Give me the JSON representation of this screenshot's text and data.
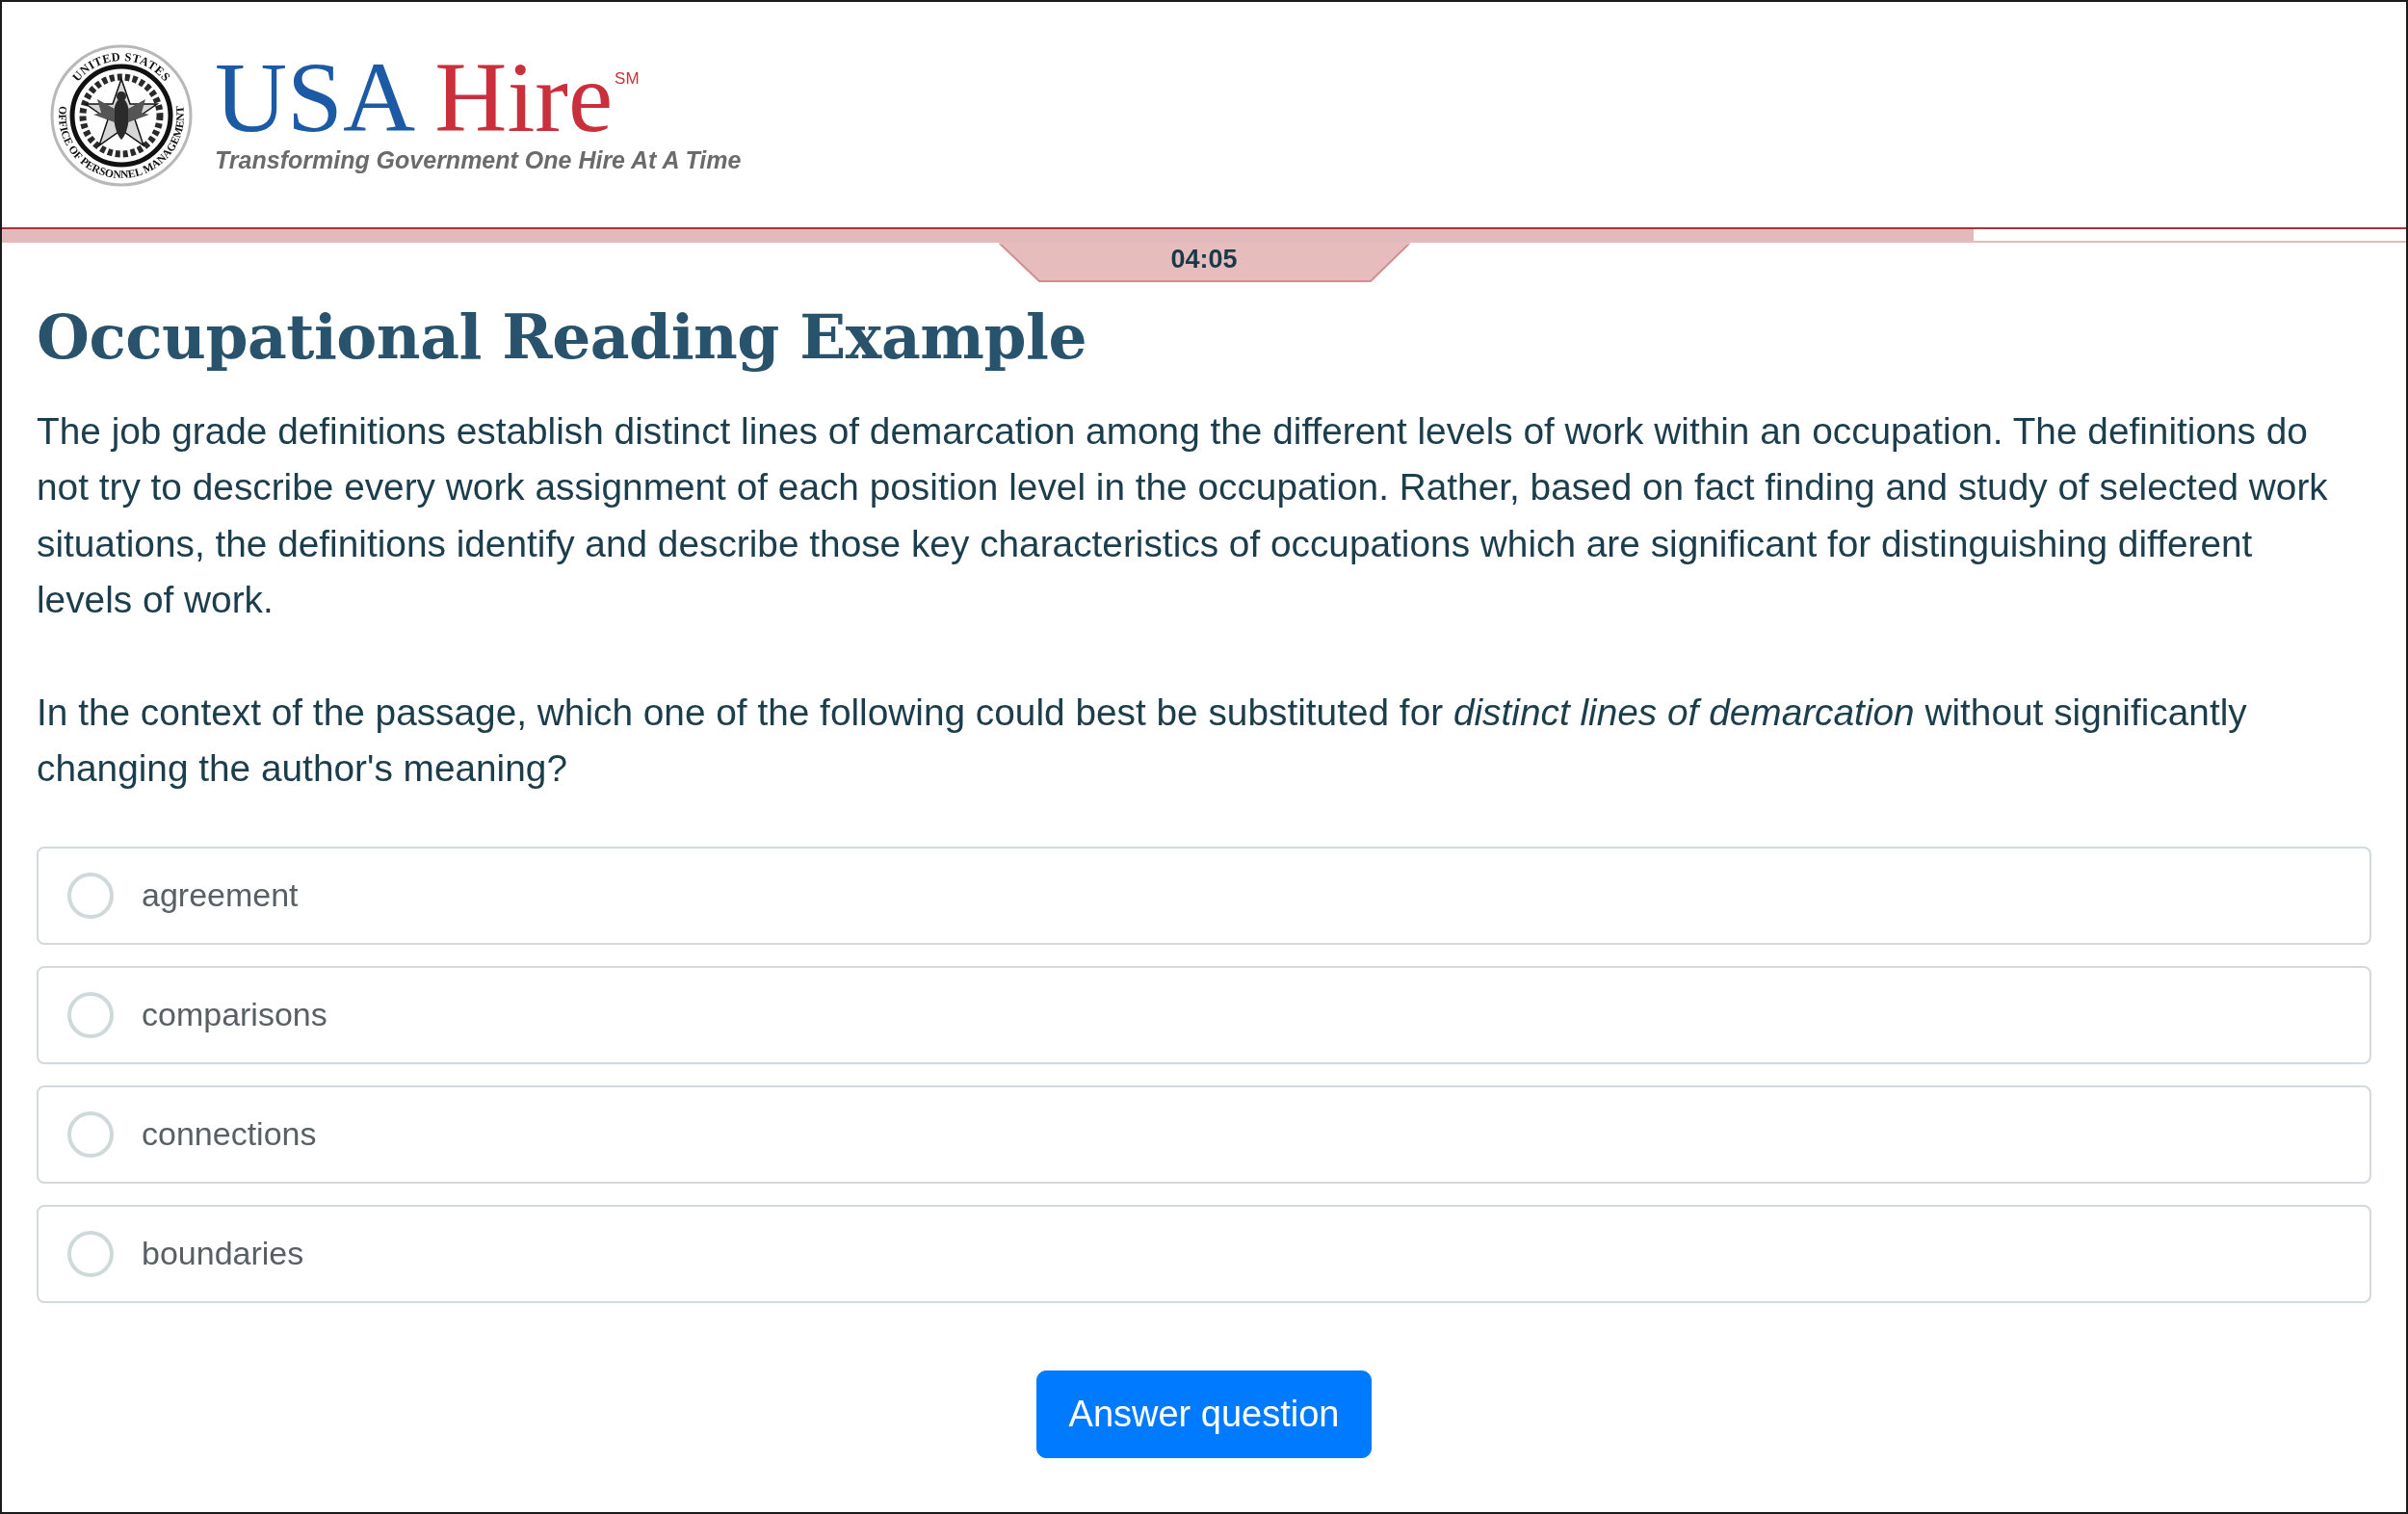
{
  "header": {
    "seal": {
      "text_top": "UNITED STATES",
      "text_bottom": "OFFICE OF PERSONNEL MANAGEMENT"
    },
    "brand": {
      "name_first": "USA",
      "name_second": "Hire",
      "service_mark": "SM",
      "tagline": "Transforming Government One Hire At A Time"
    }
  },
  "progress": {
    "level": 0.82
  },
  "timer": "04:05",
  "title": "Occupational Reading Example",
  "passage": "The job grade definitions establish distinct lines of demarcation among the different levels of work within an occupation. The definitions do not try to describe every work assignment of each position level in the occupation. Rather, based on fact finding and study of selected work situations, the definitions identify and describe those key characteristics of occupations which are significant for distinguishing different levels of work.",
  "question": "In the context of the passage, which one of the following could best be substituted for *distinct lines of demarcation* without significantly changing the author's meaning?",
  "options": [
    {
      "label": "agreement",
      "selected": false
    },
    {
      "label": "comparisons",
      "selected": false
    },
    {
      "label": "connections",
      "selected": false
    },
    {
      "label": "boundaries",
      "selected": false
    }
  ],
  "submit_button": {
    "label": "Answer question"
  }
}
